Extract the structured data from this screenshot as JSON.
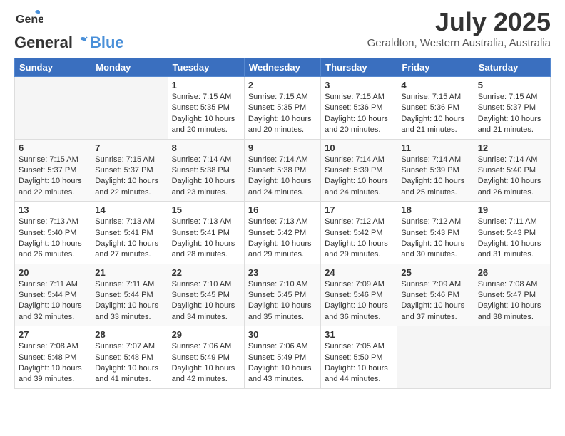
{
  "header": {
    "logo_general": "General",
    "logo_blue": "Blue",
    "month_title": "July 2025",
    "subtitle": "Geraldton, Western Australia, Australia"
  },
  "weekdays": [
    "Sunday",
    "Monday",
    "Tuesday",
    "Wednesday",
    "Thursday",
    "Friday",
    "Saturday"
  ],
  "weeks": [
    [
      {
        "day": "",
        "sunrise": "",
        "sunset": "",
        "daylight": ""
      },
      {
        "day": "",
        "sunrise": "",
        "sunset": "",
        "daylight": ""
      },
      {
        "day": "1",
        "sunrise": "Sunrise: 7:15 AM",
        "sunset": "Sunset: 5:35 PM",
        "daylight": "Daylight: 10 hours and 20 minutes."
      },
      {
        "day": "2",
        "sunrise": "Sunrise: 7:15 AM",
        "sunset": "Sunset: 5:35 PM",
        "daylight": "Daylight: 10 hours and 20 minutes."
      },
      {
        "day": "3",
        "sunrise": "Sunrise: 7:15 AM",
        "sunset": "Sunset: 5:36 PM",
        "daylight": "Daylight: 10 hours and 20 minutes."
      },
      {
        "day": "4",
        "sunrise": "Sunrise: 7:15 AM",
        "sunset": "Sunset: 5:36 PM",
        "daylight": "Daylight: 10 hours and 21 minutes."
      },
      {
        "day": "5",
        "sunrise": "Sunrise: 7:15 AM",
        "sunset": "Sunset: 5:37 PM",
        "daylight": "Daylight: 10 hours and 21 minutes."
      }
    ],
    [
      {
        "day": "6",
        "sunrise": "Sunrise: 7:15 AM",
        "sunset": "Sunset: 5:37 PM",
        "daylight": "Daylight: 10 hours and 22 minutes."
      },
      {
        "day": "7",
        "sunrise": "Sunrise: 7:15 AM",
        "sunset": "Sunset: 5:37 PM",
        "daylight": "Daylight: 10 hours and 22 minutes."
      },
      {
        "day": "8",
        "sunrise": "Sunrise: 7:14 AM",
        "sunset": "Sunset: 5:38 PM",
        "daylight": "Daylight: 10 hours and 23 minutes."
      },
      {
        "day": "9",
        "sunrise": "Sunrise: 7:14 AM",
        "sunset": "Sunset: 5:38 PM",
        "daylight": "Daylight: 10 hours and 24 minutes."
      },
      {
        "day": "10",
        "sunrise": "Sunrise: 7:14 AM",
        "sunset": "Sunset: 5:39 PM",
        "daylight": "Daylight: 10 hours and 24 minutes."
      },
      {
        "day": "11",
        "sunrise": "Sunrise: 7:14 AM",
        "sunset": "Sunset: 5:39 PM",
        "daylight": "Daylight: 10 hours and 25 minutes."
      },
      {
        "day": "12",
        "sunrise": "Sunrise: 7:14 AM",
        "sunset": "Sunset: 5:40 PM",
        "daylight": "Daylight: 10 hours and 26 minutes."
      }
    ],
    [
      {
        "day": "13",
        "sunrise": "Sunrise: 7:13 AM",
        "sunset": "Sunset: 5:40 PM",
        "daylight": "Daylight: 10 hours and 26 minutes."
      },
      {
        "day": "14",
        "sunrise": "Sunrise: 7:13 AM",
        "sunset": "Sunset: 5:41 PM",
        "daylight": "Daylight: 10 hours and 27 minutes."
      },
      {
        "day": "15",
        "sunrise": "Sunrise: 7:13 AM",
        "sunset": "Sunset: 5:41 PM",
        "daylight": "Daylight: 10 hours and 28 minutes."
      },
      {
        "day": "16",
        "sunrise": "Sunrise: 7:13 AM",
        "sunset": "Sunset: 5:42 PM",
        "daylight": "Daylight: 10 hours and 29 minutes."
      },
      {
        "day": "17",
        "sunrise": "Sunrise: 7:12 AM",
        "sunset": "Sunset: 5:42 PM",
        "daylight": "Daylight: 10 hours and 29 minutes."
      },
      {
        "day": "18",
        "sunrise": "Sunrise: 7:12 AM",
        "sunset": "Sunset: 5:43 PM",
        "daylight": "Daylight: 10 hours and 30 minutes."
      },
      {
        "day": "19",
        "sunrise": "Sunrise: 7:11 AM",
        "sunset": "Sunset: 5:43 PM",
        "daylight": "Daylight: 10 hours and 31 minutes."
      }
    ],
    [
      {
        "day": "20",
        "sunrise": "Sunrise: 7:11 AM",
        "sunset": "Sunset: 5:44 PM",
        "daylight": "Daylight: 10 hours and 32 minutes."
      },
      {
        "day": "21",
        "sunrise": "Sunrise: 7:11 AM",
        "sunset": "Sunset: 5:44 PM",
        "daylight": "Daylight: 10 hours and 33 minutes."
      },
      {
        "day": "22",
        "sunrise": "Sunrise: 7:10 AM",
        "sunset": "Sunset: 5:45 PM",
        "daylight": "Daylight: 10 hours and 34 minutes."
      },
      {
        "day": "23",
        "sunrise": "Sunrise: 7:10 AM",
        "sunset": "Sunset: 5:45 PM",
        "daylight": "Daylight: 10 hours and 35 minutes."
      },
      {
        "day": "24",
        "sunrise": "Sunrise: 7:09 AM",
        "sunset": "Sunset: 5:46 PM",
        "daylight": "Daylight: 10 hours and 36 minutes."
      },
      {
        "day": "25",
        "sunrise": "Sunrise: 7:09 AM",
        "sunset": "Sunset: 5:46 PM",
        "daylight": "Daylight: 10 hours and 37 minutes."
      },
      {
        "day": "26",
        "sunrise": "Sunrise: 7:08 AM",
        "sunset": "Sunset: 5:47 PM",
        "daylight": "Daylight: 10 hours and 38 minutes."
      }
    ],
    [
      {
        "day": "27",
        "sunrise": "Sunrise: 7:08 AM",
        "sunset": "Sunset: 5:48 PM",
        "daylight": "Daylight: 10 hours and 39 minutes."
      },
      {
        "day": "28",
        "sunrise": "Sunrise: 7:07 AM",
        "sunset": "Sunset: 5:48 PM",
        "daylight": "Daylight: 10 hours and 41 minutes."
      },
      {
        "day": "29",
        "sunrise": "Sunrise: 7:06 AM",
        "sunset": "Sunset: 5:49 PM",
        "daylight": "Daylight: 10 hours and 42 minutes."
      },
      {
        "day": "30",
        "sunrise": "Sunrise: 7:06 AM",
        "sunset": "Sunset: 5:49 PM",
        "daylight": "Daylight: 10 hours and 43 minutes."
      },
      {
        "day": "31",
        "sunrise": "Sunrise: 7:05 AM",
        "sunset": "Sunset: 5:50 PM",
        "daylight": "Daylight: 10 hours and 44 minutes."
      },
      {
        "day": "",
        "sunrise": "",
        "sunset": "",
        "daylight": ""
      },
      {
        "day": "",
        "sunrise": "",
        "sunset": "",
        "daylight": ""
      }
    ]
  ]
}
